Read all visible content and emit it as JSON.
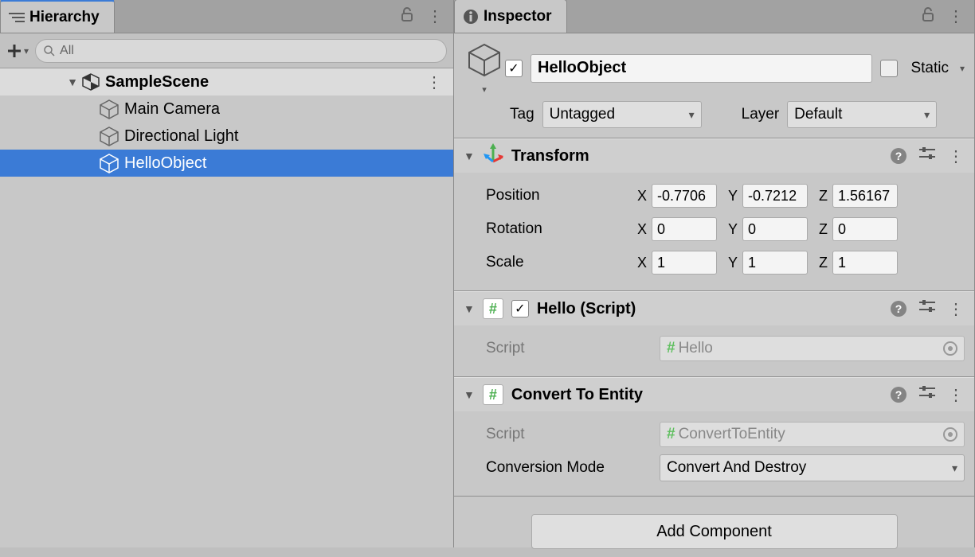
{
  "hierarchy": {
    "tab_label": "Hierarchy",
    "search_placeholder": "All",
    "scene_name": "SampleScene",
    "items": [
      {
        "name": "Main Camera",
        "selected": false
      },
      {
        "name": "Directional Light",
        "selected": false
      },
      {
        "name": "HelloObject",
        "selected": true
      }
    ]
  },
  "inspector": {
    "tab_label": "Inspector",
    "game_object": {
      "active": true,
      "name": "HelloObject",
      "static": false,
      "static_label": "Static",
      "tag_label": "Tag",
      "tag_value": "Untagged",
      "layer_label": "Layer",
      "layer_value": "Default"
    },
    "components": {
      "transform": {
        "title": "Transform",
        "position_label": "Position",
        "rotation_label": "Rotation",
        "scale_label": "Scale",
        "position": {
          "x": "-0.7706",
          "y": "-0.7212",
          "z": "1.56167"
        },
        "rotation": {
          "x": "0",
          "y": "0",
          "z": "0"
        },
        "scale": {
          "x": "1",
          "y": "1",
          "z": "1"
        }
      },
      "hello": {
        "title": "Hello (Script)",
        "enabled": true,
        "script_label": "Script",
        "script_value": "Hello"
      },
      "convert": {
        "title": "Convert To Entity",
        "script_label": "Script",
        "script_value": "ConvertToEntity",
        "mode_label": "Conversion Mode",
        "mode_value": "Convert And Destroy"
      }
    },
    "add_component_label": "Add Component"
  }
}
